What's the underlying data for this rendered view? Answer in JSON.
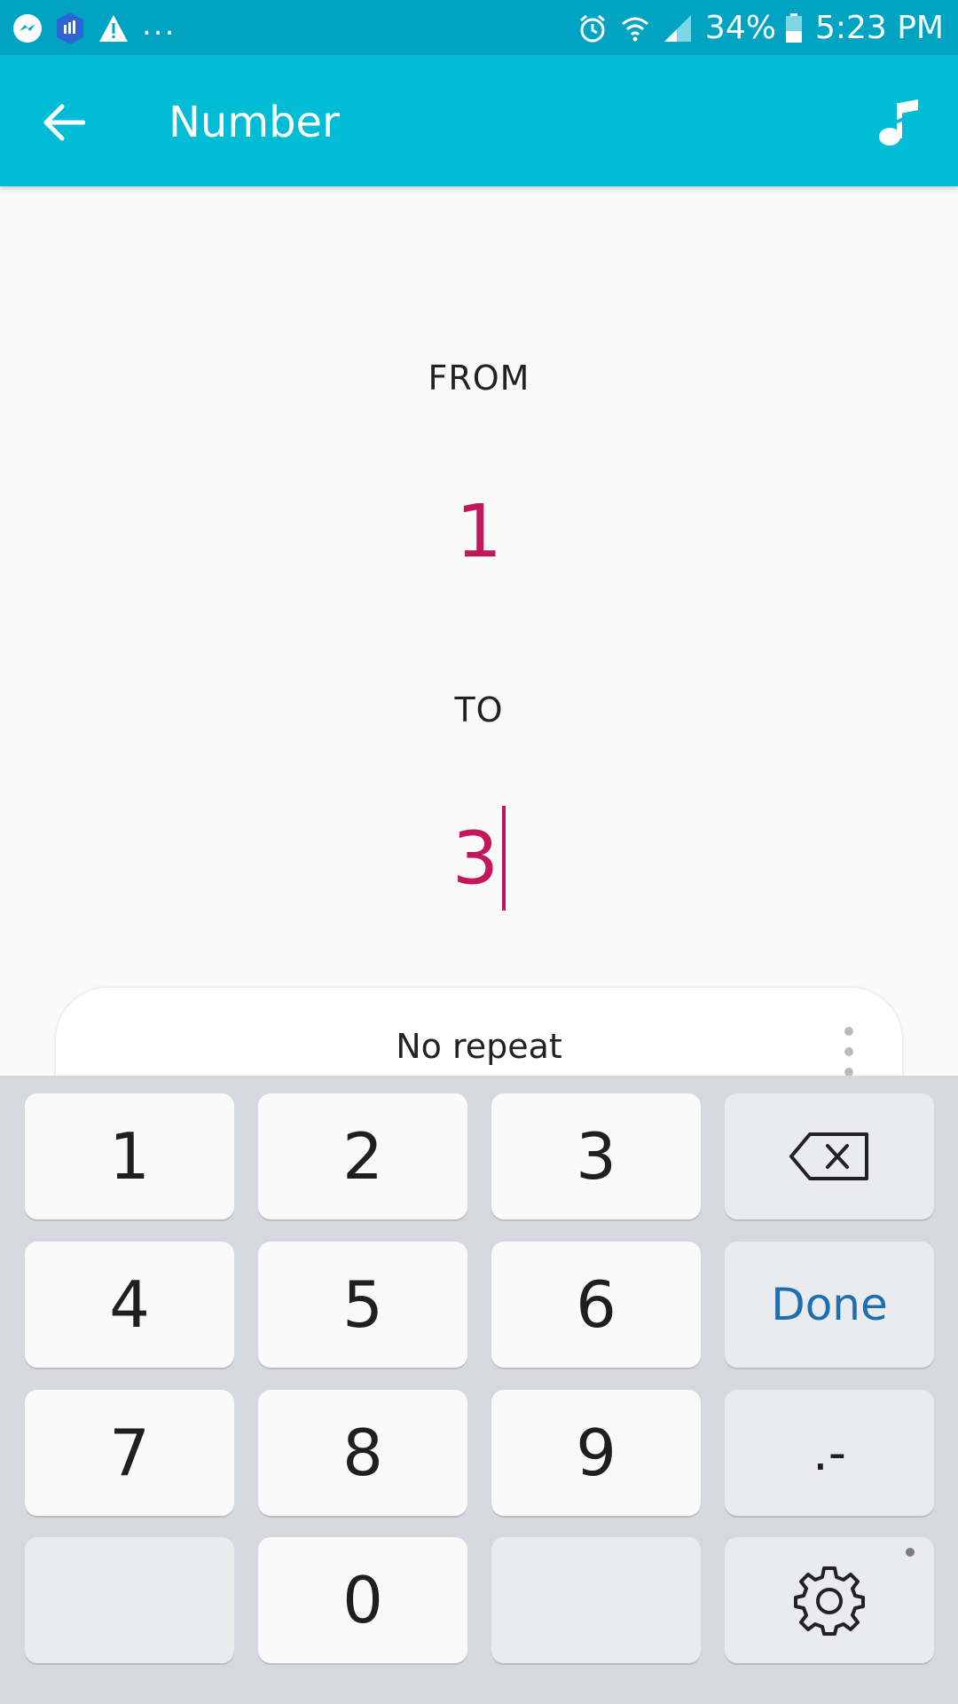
{
  "status_bar": {
    "battery_percent": "34%",
    "time": "5:23 PM",
    "left_icons": [
      "messenger-icon",
      "app-shield-icon",
      "warning-icon"
    ],
    "overflow": "...",
    "right_icons": [
      "alarm-icon",
      "wifi-icon",
      "signal-icon",
      "battery-icon"
    ]
  },
  "app_bar": {
    "title": "Number",
    "back_icon": "arrow-left-icon",
    "action_icon": "music-note-icon"
  },
  "range": {
    "from_label": "FROM",
    "from_value": "1",
    "to_label": "TO",
    "to_value": "3"
  },
  "repeat": {
    "label": "No repeat"
  },
  "keypad": {
    "digits": [
      "1",
      "2",
      "3",
      "4",
      "5",
      "6",
      "7",
      "8",
      "9",
      "0"
    ],
    "done_label": "Done",
    "symbol_label": ".-",
    "backspace_icon": "backspace-icon",
    "settings_icon": "gear-icon"
  },
  "colors": {
    "status_bar": "#00a4c2",
    "app_bar": "#00bcd4",
    "accent": "#c2185b",
    "done": "#1e6fb0",
    "keypad_bg": "#d5d8de"
  }
}
